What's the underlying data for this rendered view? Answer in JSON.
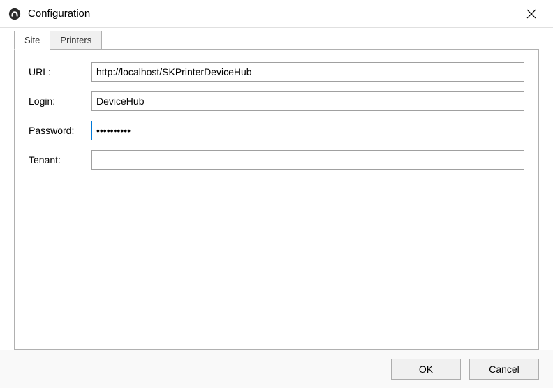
{
  "titlebar": {
    "title": "Configuration"
  },
  "tabs": {
    "site": "Site",
    "printers": "Printers"
  },
  "form": {
    "url_label": "URL:",
    "url_value": "http://localhost/SKPrinterDeviceHub",
    "login_label": "Login:",
    "login_value": "DeviceHub",
    "password_label": "Password:",
    "password_value": "••••••••••",
    "tenant_label": "Tenant:",
    "tenant_value": ""
  },
  "buttons": {
    "ok": "OK",
    "cancel": "Cancel"
  }
}
